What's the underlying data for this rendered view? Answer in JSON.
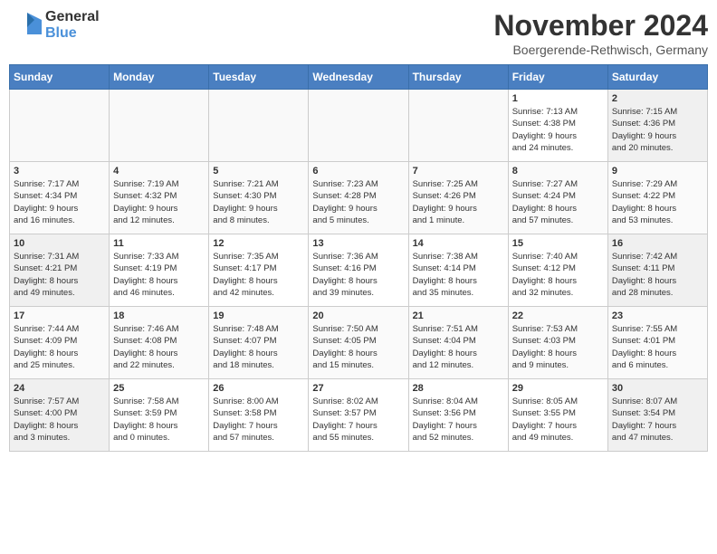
{
  "logo": {
    "general": "General",
    "blue": "Blue"
  },
  "title": "November 2024",
  "location": "Boergerende-Rethwisch, Germany",
  "days_header": [
    "Sunday",
    "Monday",
    "Tuesday",
    "Wednesday",
    "Thursday",
    "Friday",
    "Saturday"
  ],
  "weeks": [
    [
      {
        "day": "",
        "info": ""
      },
      {
        "day": "",
        "info": ""
      },
      {
        "day": "",
        "info": ""
      },
      {
        "day": "",
        "info": ""
      },
      {
        "day": "",
        "info": ""
      },
      {
        "day": "1",
        "info": "Sunrise: 7:13 AM\nSunset: 4:38 PM\nDaylight: 9 hours\nand 24 minutes."
      },
      {
        "day": "2",
        "info": "Sunrise: 7:15 AM\nSunset: 4:36 PM\nDaylight: 9 hours\nand 20 minutes."
      }
    ],
    [
      {
        "day": "3",
        "info": "Sunrise: 7:17 AM\nSunset: 4:34 PM\nDaylight: 9 hours\nand 16 minutes."
      },
      {
        "day": "4",
        "info": "Sunrise: 7:19 AM\nSunset: 4:32 PM\nDaylight: 9 hours\nand 12 minutes."
      },
      {
        "day": "5",
        "info": "Sunrise: 7:21 AM\nSunset: 4:30 PM\nDaylight: 9 hours\nand 8 minutes."
      },
      {
        "day": "6",
        "info": "Sunrise: 7:23 AM\nSunset: 4:28 PM\nDaylight: 9 hours\nand 5 minutes."
      },
      {
        "day": "7",
        "info": "Sunrise: 7:25 AM\nSunset: 4:26 PM\nDaylight: 9 hours\nand 1 minute."
      },
      {
        "day": "8",
        "info": "Sunrise: 7:27 AM\nSunset: 4:24 PM\nDaylight: 8 hours\nand 57 minutes."
      },
      {
        "day": "9",
        "info": "Sunrise: 7:29 AM\nSunset: 4:22 PM\nDaylight: 8 hours\nand 53 minutes."
      }
    ],
    [
      {
        "day": "10",
        "info": "Sunrise: 7:31 AM\nSunset: 4:21 PM\nDaylight: 8 hours\nand 49 minutes."
      },
      {
        "day": "11",
        "info": "Sunrise: 7:33 AM\nSunset: 4:19 PM\nDaylight: 8 hours\nand 46 minutes."
      },
      {
        "day": "12",
        "info": "Sunrise: 7:35 AM\nSunset: 4:17 PM\nDaylight: 8 hours\nand 42 minutes."
      },
      {
        "day": "13",
        "info": "Sunrise: 7:36 AM\nSunset: 4:16 PM\nDaylight: 8 hours\nand 39 minutes."
      },
      {
        "day": "14",
        "info": "Sunrise: 7:38 AM\nSunset: 4:14 PM\nDaylight: 8 hours\nand 35 minutes."
      },
      {
        "day": "15",
        "info": "Sunrise: 7:40 AM\nSunset: 4:12 PM\nDaylight: 8 hours\nand 32 minutes."
      },
      {
        "day": "16",
        "info": "Sunrise: 7:42 AM\nSunset: 4:11 PM\nDaylight: 8 hours\nand 28 minutes."
      }
    ],
    [
      {
        "day": "17",
        "info": "Sunrise: 7:44 AM\nSunset: 4:09 PM\nDaylight: 8 hours\nand 25 minutes."
      },
      {
        "day": "18",
        "info": "Sunrise: 7:46 AM\nSunset: 4:08 PM\nDaylight: 8 hours\nand 22 minutes."
      },
      {
        "day": "19",
        "info": "Sunrise: 7:48 AM\nSunset: 4:07 PM\nDaylight: 8 hours\nand 18 minutes."
      },
      {
        "day": "20",
        "info": "Sunrise: 7:50 AM\nSunset: 4:05 PM\nDaylight: 8 hours\nand 15 minutes."
      },
      {
        "day": "21",
        "info": "Sunrise: 7:51 AM\nSunset: 4:04 PM\nDaylight: 8 hours\nand 12 minutes."
      },
      {
        "day": "22",
        "info": "Sunrise: 7:53 AM\nSunset: 4:03 PM\nDaylight: 8 hours\nand 9 minutes."
      },
      {
        "day": "23",
        "info": "Sunrise: 7:55 AM\nSunset: 4:01 PM\nDaylight: 8 hours\nand 6 minutes."
      }
    ],
    [
      {
        "day": "24",
        "info": "Sunrise: 7:57 AM\nSunset: 4:00 PM\nDaylight: 8 hours\nand 3 minutes."
      },
      {
        "day": "25",
        "info": "Sunrise: 7:58 AM\nSunset: 3:59 PM\nDaylight: 8 hours\nand 0 minutes."
      },
      {
        "day": "26",
        "info": "Sunrise: 8:00 AM\nSunset: 3:58 PM\nDaylight: 7 hours\nand 57 minutes."
      },
      {
        "day": "27",
        "info": "Sunrise: 8:02 AM\nSunset: 3:57 PM\nDaylight: 7 hours\nand 55 minutes."
      },
      {
        "day": "28",
        "info": "Sunrise: 8:04 AM\nSunset: 3:56 PM\nDaylight: 7 hours\nand 52 minutes."
      },
      {
        "day": "29",
        "info": "Sunrise: 8:05 AM\nSunset: 3:55 PM\nDaylight: 7 hours\nand 49 minutes."
      },
      {
        "day": "30",
        "info": "Sunrise: 8:07 AM\nSunset: 3:54 PM\nDaylight: 7 hours\nand 47 minutes."
      }
    ]
  ]
}
